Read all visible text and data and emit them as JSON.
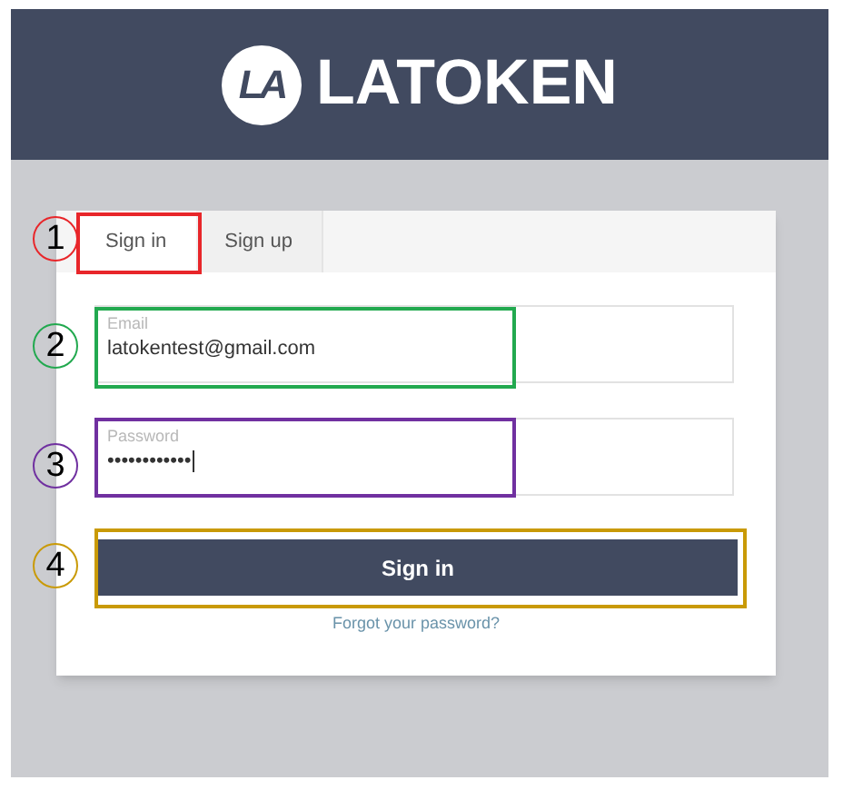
{
  "header": {
    "logo_mark": "LA",
    "brand": "LATOKEN"
  },
  "tabs": [
    {
      "label": "Sign in",
      "selected": true
    },
    {
      "label": "Sign up",
      "selected": false
    }
  ],
  "fields": [
    {
      "label": "Email",
      "value": "latokentest@gmail.com",
      "focused": false
    },
    {
      "label": "Password",
      "value": "••••••••••••",
      "focused": true
    }
  ],
  "button": "Sign in",
  "link": "Forgot your password?",
  "annotations": [
    {
      "number": "1",
      "color": "#e8262a"
    },
    {
      "number": "2",
      "color": "#22a94f"
    },
    {
      "number": "3",
      "color": "#7030a0"
    },
    {
      "number": "4",
      "color": "#c99a06"
    }
  ]
}
